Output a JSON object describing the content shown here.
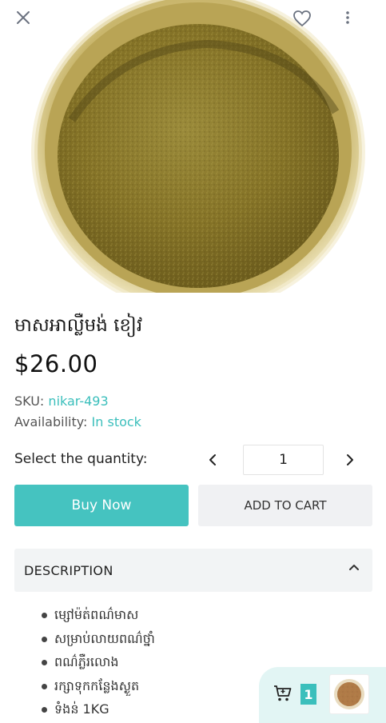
{
  "header": {
    "close_icon": "close-icon",
    "favorite_icon": "heart-outline-icon",
    "more_icon": "more-vertical-icon"
  },
  "product": {
    "title": "មាសអាល្លឺមង់ ខៀវ",
    "price": "$26.00",
    "sku_label": "SKU:",
    "sku_value": "nikar-493",
    "availability_label": "Availability:",
    "availability_value": "In stock"
  },
  "quantity": {
    "label": "Select the quantity:",
    "value": "1"
  },
  "actions": {
    "buy_now": "Buy Now",
    "add_to_cart": "ADD TO CART"
  },
  "description": {
    "title": "DESCRIPTION",
    "items": [
      "ម្សៅម៉ត់ពណ៌មាស",
      "សម្រាប់លាយពណ៌ថ្នាំ",
      "ពណ៌ភ្លឺរលោង",
      "រក្សាទុកកន្លែងស្ងួត",
      "ទំងន់ 1KG"
    ]
  },
  "cart": {
    "icon": "cart-icon",
    "count": "1"
  },
  "colors": {
    "accent": "#45c3c0",
    "accent_text": "#3bbfbc",
    "secondary_button": "#f0f1f3",
    "cart_fab_bg": "#e2f5f4",
    "powder_gold": "#8a7a2c"
  }
}
